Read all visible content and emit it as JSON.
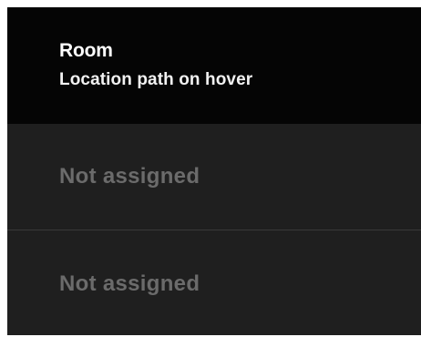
{
  "column": {
    "title": "Room",
    "subtitle": "Location path on hover"
  },
  "rows": [
    {
      "value": "Not assigned"
    },
    {
      "value": "Not assigned"
    }
  ]
}
